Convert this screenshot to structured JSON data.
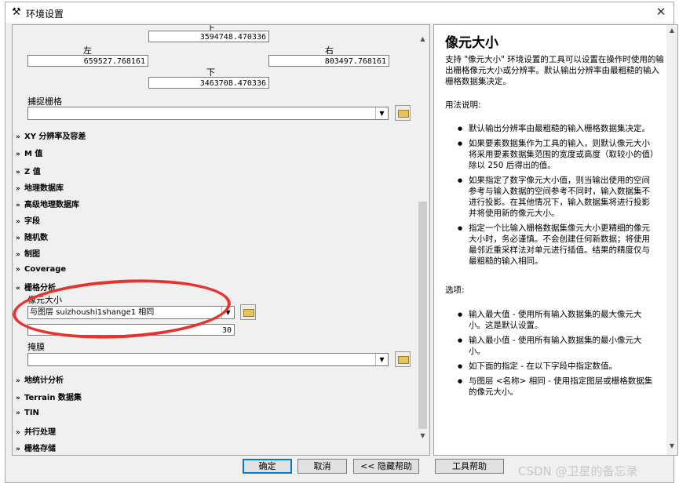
{
  "window": {
    "title": "环境设置",
    "close_glyph": "✕"
  },
  "extent": {
    "top_label": "上",
    "top_value": "3594748.470336",
    "left_label": "左",
    "left_value": "659527.768161",
    "right_label": "右",
    "right_value": "803497.768161",
    "bottom_label": "下",
    "bottom_value": "3463708.470336"
  },
  "snap": {
    "label": "捕捉栅格",
    "value": ""
  },
  "sections": [
    "XY 分辨率及容差",
    "M 值",
    "Z 值",
    "地理数据库",
    "高级地理数据库",
    "字段",
    "随机数",
    "制图",
    "Coverage"
  ],
  "raster": {
    "section_label": "栅格分析",
    "cellsize_label": "像元大小",
    "cellsize_value": "与图层 suizhoushi1shange1 相同",
    "cellsize_number": "30",
    "mask_label": "掩膜",
    "mask_value": ""
  },
  "sections_after": [
    "地统计分析",
    "Terrain 数据集",
    "TIN",
    "并行处理",
    "栅格存储"
  ],
  "buttons": {
    "ok": "确定",
    "cancel": "取消",
    "hide_help": "<< 隐藏帮助",
    "tool_help": "工具帮助"
  },
  "help": {
    "title": "像元大小",
    "intro": "支持 \"像元大小\" 环境设置的工具可以设置在操作时使用的输出栅格像元大小或分辨率。默认输出分辨率由最粗糙的输入栅格数据集决定。",
    "usage_heading": "用法说明:",
    "usage": [
      "默认输出分辨率由最粗糙的输入栅格数据集决定。",
      "如果要素数据集作为工具的输入，则默认像元大小将采用要素数据集范围的宽度或高度（取较小的值）除以 250 后得出的值。",
      "如果指定了数字像元大小值，则当输出使用的空间参考与输入数据的空间参考不同时，输入数据集不进行投影。在其他情况下，输入数据集将进行投影并将使用新的像元大小。",
      "指定一个比输入栅格数据集像元大小更精细的像元大小时，务必谨慎。不会创建任何新数据；将使用最邻近重采样法对单元进行插值。结果的精度仅与最粗糙的输入相同。"
    ],
    "options_heading": "选项:",
    "options": [
      "输入最大值 - 使用所有输入数据集的最大像元大小。这是默认设置。",
      "输入最小值 - 使用所有输入数据集的最小像元大小。",
      "如下面的指定 - 在以下字段中指定数值。",
      "与图层 <名称> 相同 - 使用指定图层或栅格数据集的像元大小。"
    ]
  },
  "watermark": "CSDN @卫星的备忘录",
  "colors": {
    "annotation": "#e8322f",
    "primary_border": "#0078d7"
  }
}
